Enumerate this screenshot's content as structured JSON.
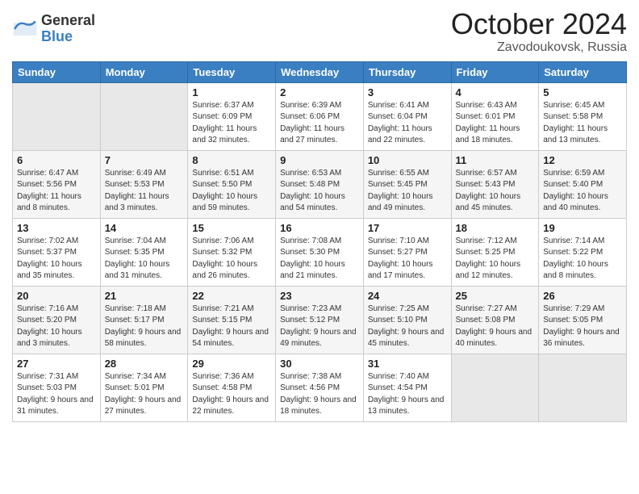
{
  "header": {
    "logo_general": "General",
    "logo_blue": "Blue",
    "month": "October 2024",
    "location": "Zavodoukovsk, Russia"
  },
  "weekdays": [
    "Sunday",
    "Monday",
    "Tuesday",
    "Wednesday",
    "Thursday",
    "Friday",
    "Saturday"
  ],
  "weeks": [
    [
      {
        "day": "",
        "info": ""
      },
      {
        "day": "",
        "info": ""
      },
      {
        "day": "1",
        "info": "Sunrise: 6:37 AM\nSunset: 6:09 PM\nDaylight: 11 hours and 32 minutes."
      },
      {
        "day": "2",
        "info": "Sunrise: 6:39 AM\nSunset: 6:06 PM\nDaylight: 11 hours and 27 minutes."
      },
      {
        "day": "3",
        "info": "Sunrise: 6:41 AM\nSunset: 6:04 PM\nDaylight: 11 hours and 22 minutes."
      },
      {
        "day": "4",
        "info": "Sunrise: 6:43 AM\nSunset: 6:01 PM\nDaylight: 11 hours and 18 minutes."
      },
      {
        "day": "5",
        "info": "Sunrise: 6:45 AM\nSunset: 5:58 PM\nDaylight: 11 hours and 13 minutes."
      }
    ],
    [
      {
        "day": "6",
        "info": "Sunrise: 6:47 AM\nSunset: 5:56 PM\nDaylight: 11 hours and 8 minutes."
      },
      {
        "day": "7",
        "info": "Sunrise: 6:49 AM\nSunset: 5:53 PM\nDaylight: 11 hours and 3 minutes."
      },
      {
        "day": "8",
        "info": "Sunrise: 6:51 AM\nSunset: 5:50 PM\nDaylight: 10 hours and 59 minutes."
      },
      {
        "day": "9",
        "info": "Sunrise: 6:53 AM\nSunset: 5:48 PM\nDaylight: 10 hours and 54 minutes."
      },
      {
        "day": "10",
        "info": "Sunrise: 6:55 AM\nSunset: 5:45 PM\nDaylight: 10 hours and 49 minutes."
      },
      {
        "day": "11",
        "info": "Sunrise: 6:57 AM\nSunset: 5:43 PM\nDaylight: 10 hours and 45 minutes."
      },
      {
        "day": "12",
        "info": "Sunrise: 6:59 AM\nSunset: 5:40 PM\nDaylight: 10 hours and 40 minutes."
      }
    ],
    [
      {
        "day": "13",
        "info": "Sunrise: 7:02 AM\nSunset: 5:37 PM\nDaylight: 10 hours and 35 minutes."
      },
      {
        "day": "14",
        "info": "Sunrise: 7:04 AM\nSunset: 5:35 PM\nDaylight: 10 hours and 31 minutes."
      },
      {
        "day": "15",
        "info": "Sunrise: 7:06 AM\nSunset: 5:32 PM\nDaylight: 10 hours and 26 minutes."
      },
      {
        "day": "16",
        "info": "Sunrise: 7:08 AM\nSunset: 5:30 PM\nDaylight: 10 hours and 21 minutes."
      },
      {
        "day": "17",
        "info": "Sunrise: 7:10 AM\nSunset: 5:27 PM\nDaylight: 10 hours and 17 minutes."
      },
      {
        "day": "18",
        "info": "Sunrise: 7:12 AM\nSunset: 5:25 PM\nDaylight: 10 hours and 12 minutes."
      },
      {
        "day": "19",
        "info": "Sunrise: 7:14 AM\nSunset: 5:22 PM\nDaylight: 10 hours and 8 minutes."
      }
    ],
    [
      {
        "day": "20",
        "info": "Sunrise: 7:16 AM\nSunset: 5:20 PM\nDaylight: 10 hours and 3 minutes."
      },
      {
        "day": "21",
        "info": "Sunrise: 7:18 AM\nSunset: 5:17 PM\nDaylight: 9 hours and 58 minutes."
      },
      {
        "day": "22",
        "info": "Sunrise: 7:21 AM\nSunset: 5:15 PM\nDaylight: 9 hours and 54 minutes."
      },
      {
        "day": "23",
        "info": "Sunrise: 7:23 AM\nSunset: 5:12 PM\nDaylight: 9 hours and 49 minutes."
      },
      {
        "day": "24",
        "info": "Sunrise: 7:25 AM\nSunset: 5:10 PM\nDaylight: 9 hours and 45 minutes."
      },
      {
        "day": "25",
        "info": "Sunrise: 7:27 AM\nSunset: 5:08 PM\nDaylight: 9 hours and 40 minutes."
      },
      {
        "day": "26",
        "info": "Sunrise: 7:29 AM\nSunset: 5:05 PM\nDaylight: 9 hours and 36 minutes."
      }
    ],
    [
      {
        "day": "27",
        "info": "Sunrise: 7:31 AM\nSunset: 5:03 PM\nDaylight: 9 hours and 31 minutes."
      },
      {
        "day": "28",
        "info": "Sunrise: 7:34 AM\nSunset: 5:01 PM\nDaylight: 9 hours and 27 minutes."
      },
      {
        "day": "29",
        "info": "Sunrise: 7:36 AM\nSunset: 4:58 PM\nDaylight: 9 hours and 22 minutes."
      },
      {
        "day": "30",
        "info": "Sunrise: 7:38 AM\nSunset: 4:56 PM\nDaylight: 9 hours and 18 minutes."
      },
      {
        "day": "31",
        "info": "Sunrise: 7:40 AM\nSunset: 4:54 PM\nDaylight: 9 hours and 13 minutes."
      },
      {
        "day": "",
        "info": ""
      },
      {
        "day": "",
        "info": ""
      }
    ]
  ]
}
